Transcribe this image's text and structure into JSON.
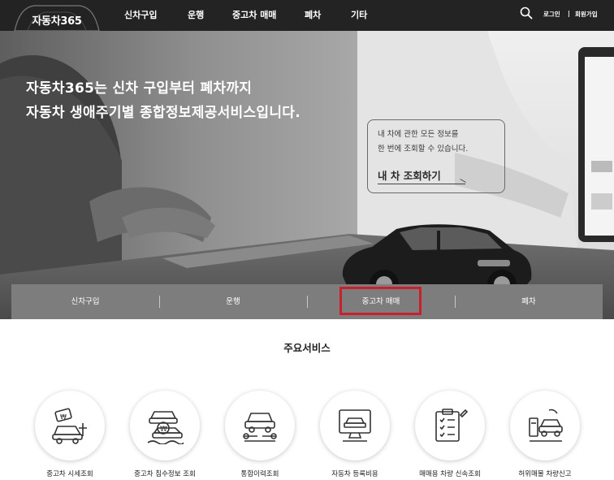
{
  "nav": {
    "logo": "자동차365",
    "menu": [
      "신차구입",
      "운행",
      "중고차 매매",
      "폐차",
      "기타"
    ],
    "login": "로그인",
    "separator": "|",
    "signup": "회원가입"
  },
  "hero": {
    "headline_1": "자동차365는 신차 구입부터 폐차까지",
    "headline_2": "자동차 생애주기별 종합정보제공서비스입니다.",
    "info_line_1": "내 차에 관한 모든 정보를",
    "info_line_2": "한 번에 조회할 수 있습니다.",
    "cta": "내 차 조회하기"
  },
  "categories": [
    "신차구입",
    "운행",
    "중고차 매매",
    "폐차"
  ],
  "services": {
    "title": "주요서비스",
    "items": [
      {
        "label": "중고차 시세조회",
        "icon": "car-price-icon"
      },
      {
        "label": "중고차 침수정보 조회",
        "icon": "flooded-car-icon"
      },
      {
        "label": "통합이력조회",
        "icon": "car-repair-icon"
      },
      {
        "label": "자동차 등록비용",
        "icon": "computer-registration-icon"
      },
      {
        "label": "매매용 차량 신속조회",
        "icon": "checklist-icon"
      },
      {
        "label": "허위매물 차량신고",
        "icon": "car-report-icon"
      }
    ]
  },
  "colors": {
    "nav_bg": "#232323",
    "category_bar": "#7d7d7d",
    "highlight": "#c9202b"
  }
}
